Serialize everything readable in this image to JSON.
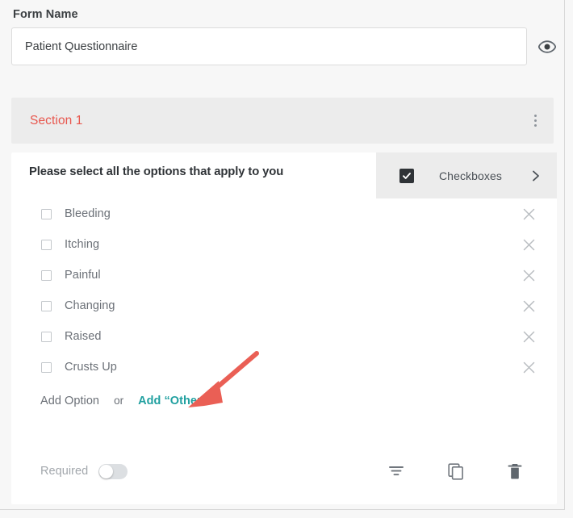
{
  "form": {
    "name_label": "Form Name",
    "name_value": "Patient Questionnaire",
    "name_placeholder": "Form Name",
    "preview_icon": "eye-icon"
  },
  "section": {
    "title": "Section 1",
    "menu_icon": "more-vertical-icon"
  },
  "question": {
    "title": "Please select all the options that apply to you",
    "type_label": "Checkboxes",
    "type_icon": "checkbox-checked-icon",
    "type_chevron_icon": "chevron-right-icon",
    "options": [
      {
        "label": "Bleeding",
        "checked": false,
        "remove_icon": "close-icon"
      },
      {
        "label": "Itching",
        "checked": false,
        "remove_icon": "close-icon"
      },
      {
        "label": "Painful",
        "checked": false,
        "remove_icon": "close-icon"
      },
      {
        "label": "Changing",
        "checked": false,
        "remove_icon": "close-icon"
      },
      {
        "label": "Raised",
        "checked": false,
        "remove_icon": "close-icon"
      },
      {
        "label": "Crusts Up",
        "checked": false,
        "remove_icon": "close-icon"
      }
    ],
    "add_option_label": "Add Option",
    "add_or_label": "or",
    "add_other_label": "Add “Other”"
  },
  "footer": {
    "required_label": "Required",
    "required_on": false,
    "logic_icon": "filter-icon",
    "duplicate_icon": "copy-icon",
    "delete_icon": "trash-icon"
  },
  "colors": {
    "page_background": "#f7f7f7",
    "card_background": "#ffffff",
    "section_background": "#ececec",
    "section_title": "#e8574e",
    "accent_link": "#21a0a0",
    "muted_text": "#6b7077",
    "heading_text": "#2f3337",
    "annotation_arrow": "#ea5f55"
  },
  "annotation": {
    "type": "arrow",
    "points_to": "add-other-link"
  }
}
